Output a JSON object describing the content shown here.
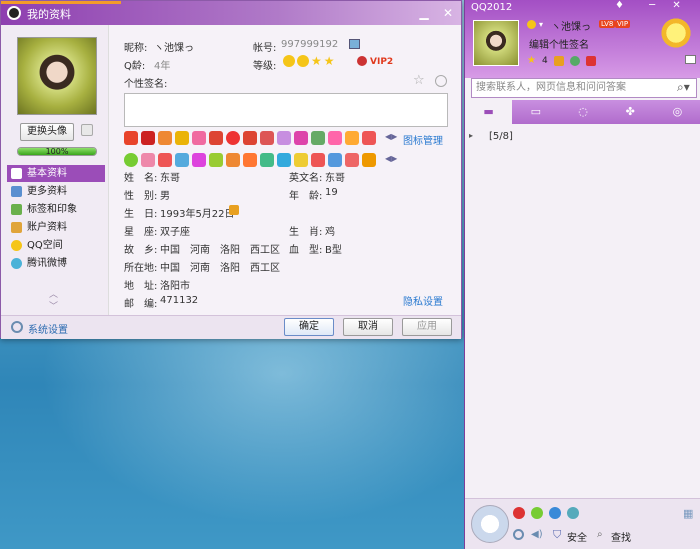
{
  "profile_window": {
    "title": "我的资料",
    "change_avatar": "更换头像",
    "progress_text": "100%",
    "progress_value": 1.0,
    "nav": [
      "基本资料",
      "更多资料",
      "标签和印象",
      "账户资料",
      "QQ空间",
      "腾讯微博"
    ],
    "nickname_label": "昵称:",
    "nickname": "ヽ池馃っ",
    "account_label": "帐号:",
    "account": "997999192",
    "qage_label": "Q龄:",
    "qage": "4年",
    "level_label": "等级:",
    "vip_badge": "VIP2",
    "signature_label": "个性签名:",
    "icon_manage": "图标管理",
    "fields": [
      {
        "label": "姓　名:",
        "value": "东哥"
      },
      {
        "label": "性　别:",
        "value": "男"
      },
      {
        "label": "生　日:",
        "value": "1993年5月22日"
      },
      {
        "label": "星　座:",
        "value": "双子座"
      },
      {
        "label": "故　乡:",
        "value": "中国　河南　洛阳　西工区"
      },
      {
        "label": "所在地:",
        "value": "中国　河南　洛阳　西工区"
      },
      {
        "label": "地　址:",
        "value": "洛阳市"
      },
      {
        "label": "邮　编:",
        "value": "471132"
      }
    ],
    "fields_right": [
      {
        "label": "英文名:",
        "value": "东哥"
      },
      {
        "label": "年　龄:",
        "value": "19"
      },
      {
        "label": "生　肖:",
        "value": "鸡"
      },
      {
        "label": "血　型:",
        "value": "B型"
      }
    ],
    "privacy": "隐私设置",
    "settings": "系统设置",
    "ok": "确定",
    "cancel": "取消",
    "apply": "应用"
  },
  "qq_panel": {
    "title": "QQ2012",
    "nickname": "ヽ池馃っ",
    "status_tag": "LV8",
    "vip_tag": "VIP",
    "signature": "编辑个性签名",
    "level_count": "4",
    "search_placeholder": "搜索联系人，网页信息和问问答案",
    "group_count": "[5/8]",
    "security": "安全",
    "find": "查找"
  }
}
